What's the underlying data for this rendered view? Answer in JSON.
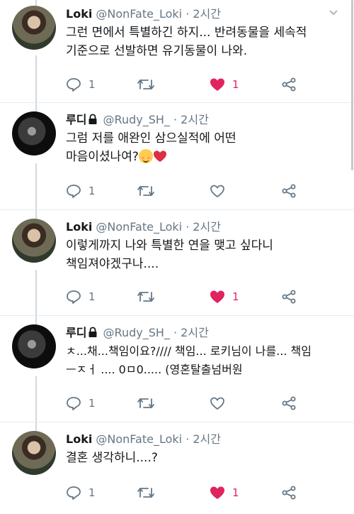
{
  "tweets": [
    {
      "name": "Loki",
      "handle": "@NonFate_Loki",
      "time": "· 2시간",
      "line1": "그런 면에서 특별하긴 하지... 반려동물을 세속적",
      "line2": "기준으로 선발하면 유기동물이 나와.",
      "reply_count": "1",
      "retweet_count": "",
      "like_count": "1"
    },
    {
      "name": "루디",
      "handle": "@Rudy_SH_",
      "time": "· 2시간",
      "line1": "그럼 저를 애완인 삼으실적에 어떤",
      "line2": "마음이셨나여?",
      "reply_count": "1",
      "retweet_count": "",
      "like_count": ""
    },
    {
      "name": "Loki",
      "handle": "@NonFate_Loki",
      "time": "· 2시간",
      "line1": "이렇게까지 나와 특별한 연을 맺고 싶다니",
      "line2": "책임져야겠구나....",
      "reply_count": "1",
      "retweet_count": "",
      "like_count": "1"
    },
    {
      "name": "루디",
      "handle": "@Rudy_SH_",
      "time": "· 2시간",
      "line1": "ㅊ...채...책임이요?//// 책임... 로키님이 나를... 책임",
      "line2": "ㅡㅈㅓ .... 0ㅁ0..... (영혼탈출넘버원",
      "reply_count": "1",
      "retweet_count": "",
      "like_count": ""
    },
    {
      "name": "Loki",
      "handle": "@NonFate_Loki",
      "time": "· 2시간",
      "line1": "결혼 생각하니....?",
      "line2": "",
      "reply_count": "1",
      "retweet_count": "",
      "like_count": "1"
    }
  ],
  "colors": {
    "like_active": "#e0245e",
    "muted": "#657786"
  }
}
